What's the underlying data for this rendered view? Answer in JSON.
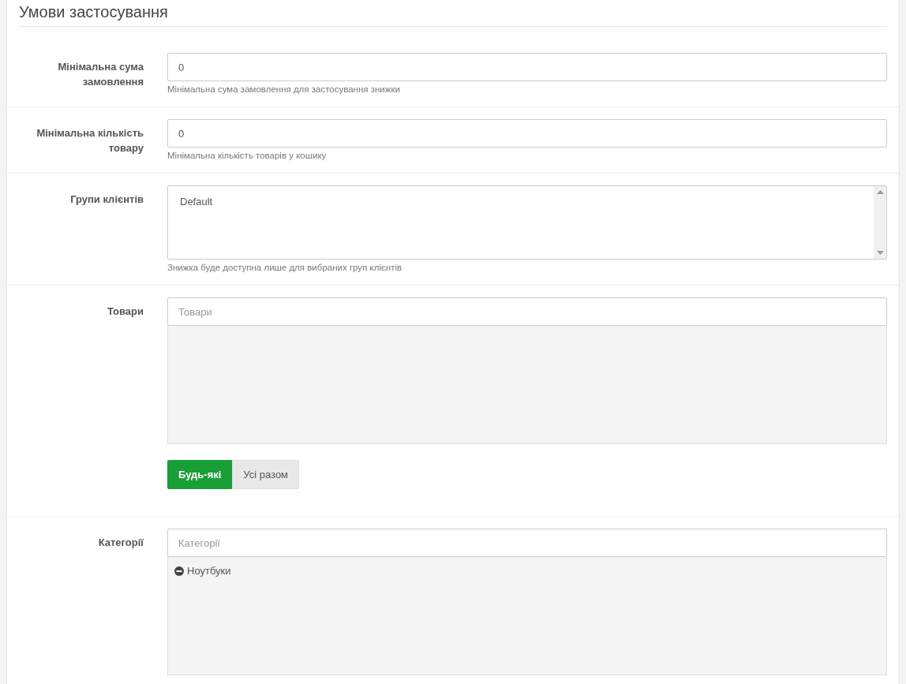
{
  "section_title": "Умови застосування",
  "rows": [
    {
      "kind": "input",
      "label": "Мінімальна сума замовлення",
      "value": "0",
      "help": "Мінімальна сума замовлення для застосування знижки"
    },
    {
      "kind": "input",
      "label": "Мінімальна кількість товару",
      "value": "0",
      "help": "Мінімальна кількість товарів у кошику"
    },
    {
      "kind": "listbox",
      "label": "Групи клієнтів",
      "options": [
        "Default"
      ],
      "help": "Знижка буде доступна лише для вибраних груп клієнтів"
    },
    {
      "kind": "picker",
      "label": "Товари",
      "placeholder": "Товари",
      "items": [],
      "buttons": [
        {
          "label": "Будь-які",
          "selected": true
        },
        {
          "label": "Усі разом",
          "selected": false
        }
      ]
    },
    {
      "kind": "picker",
      "label": "Категорії",
      "placeholder": "Категорії",
      "items": [
        "Ноутбуки"
      ]
    }
  ]
}
